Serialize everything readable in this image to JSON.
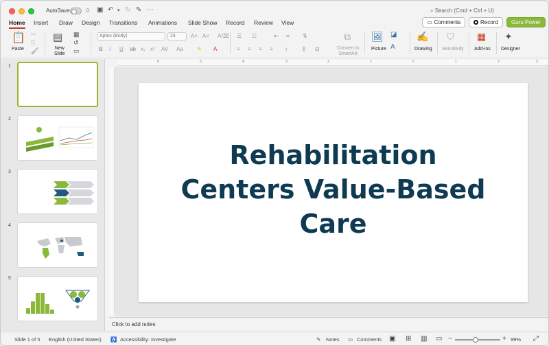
{
  "titlebar": {
    "autosave_label": "AutoSave",
    "search_placeholder": "Search (Cmd + Ctrl + U)"
  },
  "tabs": [
    {
      "label": "Home",
      "active": true
    },
    {
      "label": "Insert"
    },
    {
      "label": "Draw"
    },
    {
      "label": "Design"
    },
    {
      "label": "Transitions"
    },
    {
      "label": "Animations"
    },
    {
      "label": "Slide Show"
    },
    {
      "label": "Record"
    },
    {
      "label": "Review"
    },
    {
      "label": "View"
    }
  ],
  "actions": {
    "comments": "Comments",
    "record": "Record",
    "guru": "Guru Power"
  },
  "ribbon": {
    "paste": "Paste",
    "new_slide": "New\nSlide",
    "font_name": "Aptos (Body)",
    "font_size": "24",
    "convert_smartart": "Convert to\nSmartArt",
    "picture": "Picture",
    "drawing": "Drawing",
    "sensitivity": "Sensitivity",
    "addins": "Add-ins",
    "designer": "Designer"
  },
  "slides": [
    {
      "number": "1",
      "selected": true
    },
    {
      "number": "2"
    },
    {
      "number": "3"
    },
    {
      "number": "4"
    },
    {
      "number": "5"
    }
  ],
  "slide": {
    "title": "Rehabilitation\nCenters Value-Based\nCare"
  },
  "notes_placeholder": "Click to add notes",
  "statusbar": {
    "slide_info": "Slide 1 of 5",
    "language": "English (United States)",
    "accessibility": "Accessibility: Investigate",
    "notes": "Notes",
    "comments": "Comments",
    "zoom": "99%"
  },
  "colors": {
    "accent_tab": "#c43e1c",
    "guru": "#8bb73b",
    "title": "#0e3a52",
    "selected_thumb": "#9ab52e"
  }
}
